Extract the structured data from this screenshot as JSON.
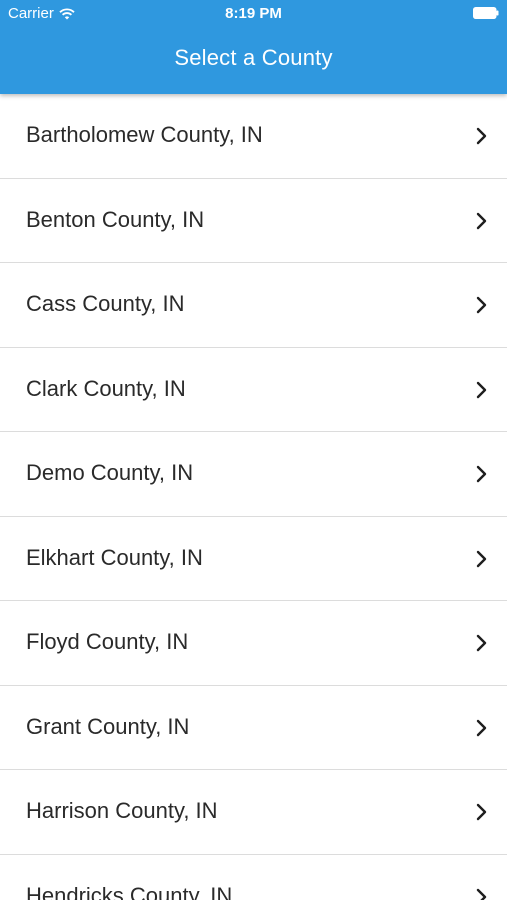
{
  "status_bar": {
    "carrier": "Carrier",
    "time": "8:19 PM",
    "icons": [
      "wifi-icon",
      "battery-icon"
    ]
  },
  "header": {
    "title": "Select a County",
    "color": "#2f98df"
  },
  "counties": [
    {
      "label": "Bartholomew County, IN"
    },
    {
      "label": "Benton County, IN"
    },
    {
      "label": "Cass County, IN"
    },
    {
      "label": "Clark County, IN"
    },
    {
      "label": "Demo County, IN"
    },
    {
      "label": "Elkhart County, IN"
    },
    {
      "label": "Floyd County, IN"
    },
    {
      "label": "Grant County, IN"
    },
    {
      "label": "Harrison County, IN"
    },
    {
      "label": "Hendricks County, IN"
    }
  ],
  "row_icon": "chevron-right-icon"
}
